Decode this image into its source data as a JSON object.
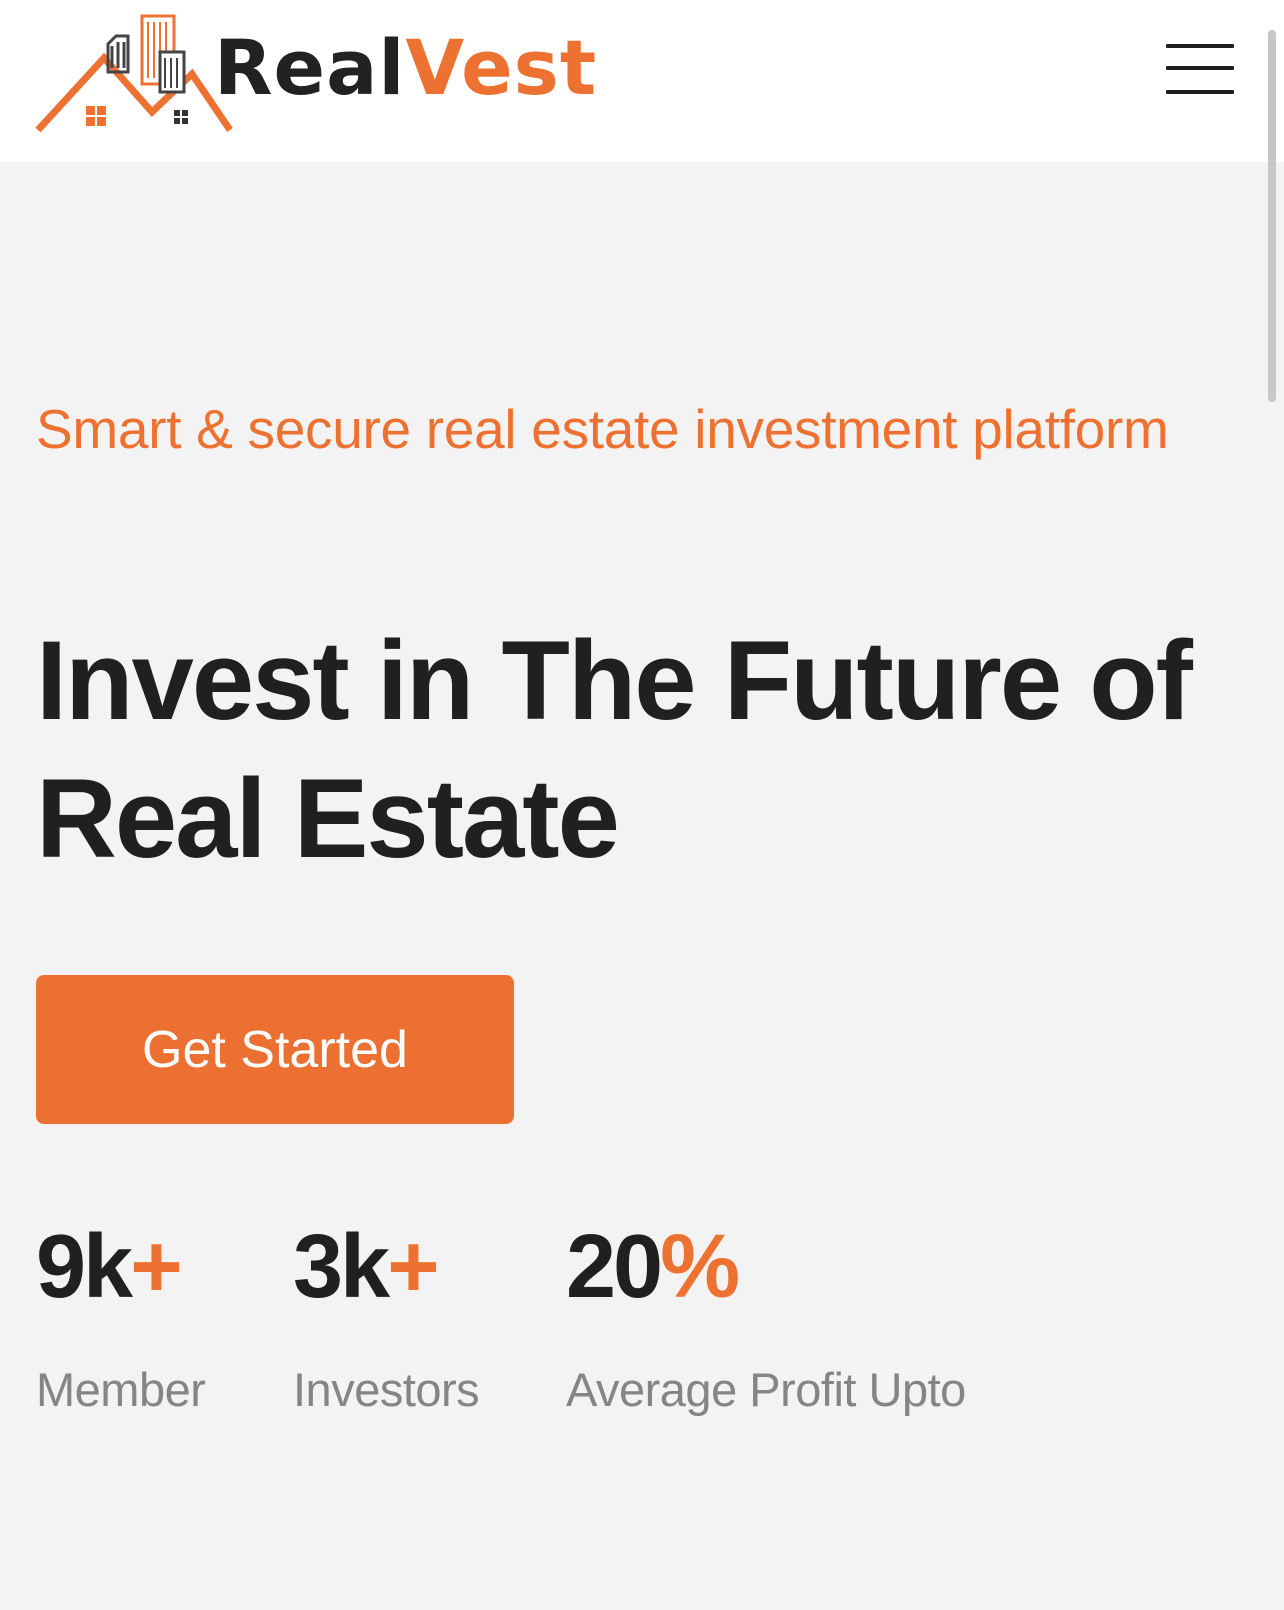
{
  "header": {
    "brand_part1": "Real",
    "brand_part2": "Vest",
    "logo_icon": "house-roof-buildings-icon",
    "menu_icon": "hamburger-menu-icon"
  },
  "hero": {
    "tagline": "Smart & secure real estate investment platform",
    "headline": "Invest in The Future of Real Estate",
    "cta_label": "Get Started"
  },
  "stats": [
    {
      "value": "9k",
      "accent": "+",
      "label": "Member"
    },
    {
      "value": "3k",
      "accent": "+",
      "label": "Investors"
    },
    {
      "value": "20",
      "accent": "%",
      "label": "Average Profit Upto"
    }
  ],
  "colors": {
    "accent": "#ed7232",
    "text_dark": "#202020",
    "text_muted": "#858585",
    "background": "#f3f3f3",
    "header_bg": "#ffffff"
  }
}
